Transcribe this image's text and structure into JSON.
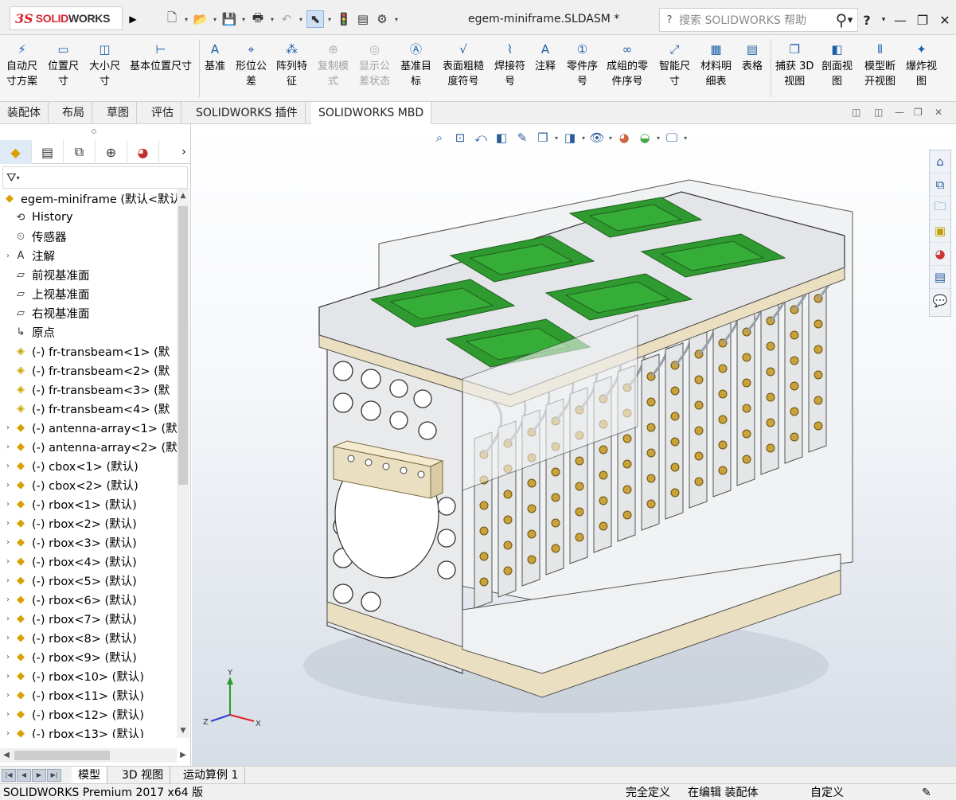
{
  "app": {
    "brand_ds": "3S",
    "brand_name_a": "SOLID",
    "brand_name_b": "WORKS",
    "doc_title": "egem-miniframe.SLDASM *",
    "search_placeholder": "搜索 SOLIDWORKS 帮助",
    "help": "?",
    "window_controls": [
      "—",
      "❐",
      "✕"
    ]
  },
  "quick_access": [
    "new-icon",
    "open-icon",
    "save-icon",
    "print-icon",
    "undo-icon",
    "select-icon",
    "rebuild-icon",
    "file-properties-icon",
    "options-icon"
  ],
  "ribbon": [
    {
      "label": "自动尺\n寸方案",
      "icon": "⚡",
      "disabled": false
    },
    {
      "label": "位置尺\n寸",
      "icon": "▭",
      "disabled": false
    },
    {
      "label": "大小尺\n寸",
      "icon": "◫",
      "disabled": false
    },
    {
      "label": "基本位置尺寸",
      "icon": "⊢",
      "disabled": false
    },
    {
      "label": "基准",
      "icon": "A",
      "disabled": false
    },
    {
      "label": "形位公\n差",
      "icon": "⌖",
      "disabled": false
    },
    {
      "label": "阵列特\n征",
      "icon": "⁂",
      "disabled": false
    },
    {
      "label": "复制模\n式",
      "icon": "⊕",
      "disabled": true
    },
    {
      "label": "显示公\n差状态",
      "icon": "◎",
      "disabled": true
    },
    {
      "label": "基准目\n标",
      "icon": "Ⓐ",
      "disabled": false
    },
    {
      "label": "表面粗糙\n度符号",
      "icon": "√",
      "disabled": false
    },
    {
      "label": "焊接符\n号",
      "icon": "⌇",
      "disabled": false
    },
    {
      "label": "注释",
      "icon": "A",
      "disabled": false
    },
    {
      "label": "零件序\n号",
      "icon": "①",
      "disabled": false
    },
    {
      "label": "成组的零\n件序号",
      "icon": "∞",
      "disabled": false
    },
    {
      "label": "智能尺\n寸",
      "icon": "⤢",
      "disabled": false
    },
    {
      "label": "材料明\n细表",
      "icon": "▦",
      "disabled": false
    },
    {
      "label": "表格",
      "icon": "▤",
      "disabled": false
    },
    {
      "label": "捕获 3D\n视图",
      "icon": "❐",
      "disabled": false
    },
    {
      "label": "剖面视\n图",
      "icon": "◧",
      "disabled": false
    },
    {
      "label": "模型断\n开视图",
      "icon": "⫴",
      "disabled": false
    },
    {
      "label": "爆炸视\n图",
      "icon": "✦",
      "disabled": false
    }
  ],
  "tabs": [
    "装配体",
    "布局",
    "草图",
    "评估",
    "SOLIDWORKS 插件",
    "SOLIDWORKS MBD"
  ],
  "active_tab": "SOLIDWORKS MBD",
  "feature_manager": {
    "root": "egem-miniframe  (默认<默认",
    "items": [
      {
        "label": "History",
        "icon": "history-icon",
        "expand": false
      },
      {
        "label": "传感器",
        "icon": "sensor-icon",
        "expand": false
      },
      {
        "label": "注解",
        "icon": "annotation-icon",
        "expand": true
      },
      {
        "label": "前视基准面",
        "icon": "plane-icon",
        "expand": false
      },
      {
        "label": "上视基准面",
        "icon": "plane-icon",
        "expand": false
      },
      {
        "label": "右视基准面",
        "icon": "plane-icon",
        "expand": false
      },
      {
        "label": "原点",
        "icon": "origin-icon",
        "expand": false
      },
      {
        "label": "(-) fr-transbeam<1> (默",
        "icon": "part-icon",
        "expand": false
      },
      {
        "label": "(-) fr-transbeam<2> (默",
        "icon": "part-icon",
        "expand": false
      },
      {
        "label": "(-) fr-transbeam<3> (默",
        "icon": "part-icon",
        "expand": false
      },
      {
        "label": "(-) fr-transbeam<4> (默",
        "icon": "part-icon",
        "expand": false
      },
      {
        "label": "(-) antenna-array<1> (默",
        "icon": "assembly-icon",
        "expand": true
      },
      {
        "label": "(-) antenna-array<2> (默",
        "icon": "assembly-icon",
        "expand": true
      },
      {
        "label": "(-) cbox<1> (默认)",
        "icon": "assembly-icon",
        "expand": true
      },
      {
        "label": "(-) cbox<2> (默认)",
        "icon": "assembly-icon",
        "expand": true
      },
      {
        "label": "(-) rbox<1> (默认)",
        "icon": "assembly-icon",
        "expand": true
      },
      {
        "label": "(-) rbox<2> (默认)",
        "icon": "assembly-icon",
        "expand": true
      },
      {
        "label": "(-) rbox<3> (默认)",
        "icon": "assembly-icon",
        "expand": true
      },
      {
        "label": "(-) rbox<4> (默认)",
        "icon": "assembly-icon",
        "expand": true
      },
      {
        "label": "(-) rbox<5> (默认)",
        "icon": "assembly-icon",
        "expand": true
      },
      {
        "label": "(-) rbox<6> (默认)",
        "icon": "assembly-icon",
        "expand": true
      },
      {
        "label": "(-) rbox<7> (默认)",
        "icon": "assembly-icon",
        "expand": true
      },
      {
        "label": "(-) rbox<8> (默认)",
        "icon": "assembly-icon",
        "expand": true
      },
      {
        "label": "(-) rbox<9> (默认)",
        "icon": "assembly-icon",
        "expand": true
      },
      {
        "label": "(-) rbox<10> (默认)",
        "icon": "assembly-icon",
        "expand": true
      },
      {
        "label": "(-) rbox<11> (默认)",
        "icon": "assembly-icon",
        "expand": true
      },
      {
        "label": "(-) rbox<12> (默认)",
        "icon": "assembly-icon",
        "expand": true
      },
      {
        "label": "(-) rbox<13> (默认)",
        "icon": "assembly-icon",
        "expand": true
      }
    ]
  },
  "triad": {
    "x": "X",
    "y": "Y",
    "z": "Z"
  },
  "bottom_tabs": [
    "模型",
    "3D 视图",
    "运动算例 1"
  ],
  "status": {
    "product": "SOLIDWORKS Premium 2017 x64 版",
    "definition": "完全定义",
    "editing": "在编辑 装配体",
    "units": "自定义"
  },
  "colors": {
    "brand_red": "#d9232d",
    "pcb_green": "#2f9a2f",
    "frame_gray": "#e4e6e8",
    "beige": "#eadfc0"
  }
}
